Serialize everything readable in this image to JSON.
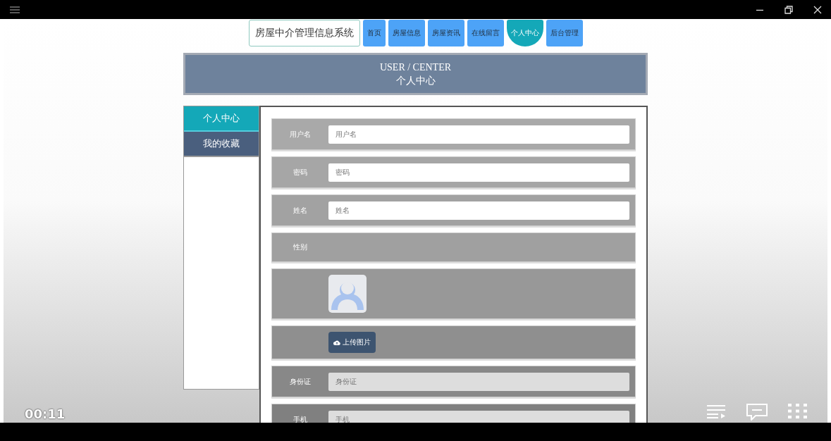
{
  "nav": {
    "brand": "房屋中介管理信息系统",
    "items": [
      {
        "label": "首页",
        "selected": false
      },
      {
        "label": "房屋信息",
        "selected": false
      },
      {
        "label": "房屋资讯",
        "selected": false
      },
      {
        "label": "在线留言",
        "selected": false
      },
      {
        "label": "个人中心",
        "selected": true
      },
      {
        "label": "后台管理",
        "selected": false
      }
    ]
  },
  "banner": {
    "title": "USER / CENTER",
    "subtitle": "个人中心"
  },
  "sidebar": {
    "items": [
      {
        "label": "个人中心",
        "selected": true
      },
      {
        "label": "我的收藏",
        "selected": false
      }
    ]
  },
  "form": {
    "rows": [
      {
        "kind": "field",
        "label": "用户名",
        "placeholder": "用户名"
      },
      {
        "kind": "field",
        "label": "密码",
        "placeholder": "密码"
      },
      {
        "kind": "field",
        "label": "姓名",
        "placeholder": "姓名"
      },
      {
        "kind": "select",
        "label": "性别"
      },
      {
        "kind": "avatar"
      },
      {
        "kind": "upload",
        "button": "上传图片"
      },
      {
        "kind": "field",
        "label": "身份证",
        "placeholder": "身份证"
      },
      {
        "kind": "field",
        "label": "手机",
        "placeholder": "手机"
      }
    ]
  },
  "player": {
    "time": "00:11"
  }
}
